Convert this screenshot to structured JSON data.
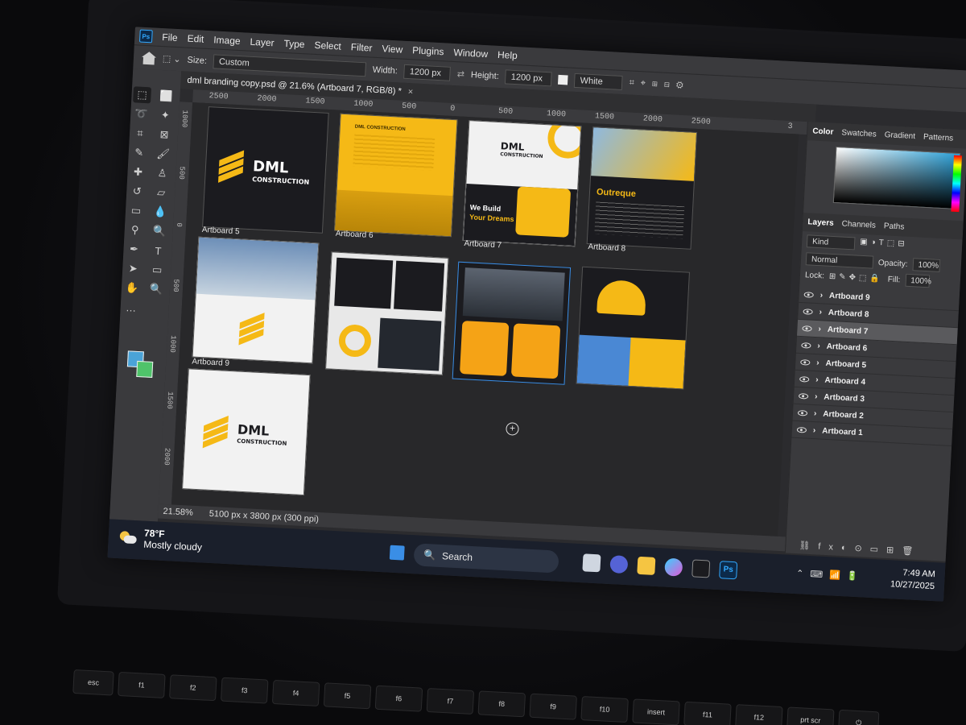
{
  "app": {
    "logo": "Ps",
    "menu": [
      "File",
      "Edit",
      "Image",
      "Layer",
      "Type",
      "Select",
      "Filter",
      "View",
      "Plugins",
      "Window",
      "Help"
    ]
  },
  "options": {
    "size_label": "Size:",
    "size_value": "Custom",
    "width_label": "Width:",
    "width_value": "1200 px",
    "height_label": "Height:",
    "height_value": "1200 px",
    "fill_value": "White"
  },
  "document": {
    "tab_title": "dml branding copy.psd @ 21.6% (Artboard 7, RGB/8) *",
    "zoom": "21.58%",
    "doc_size": "5100 px x 3800 px (300 ppi)"
  },
  "ruler_h": [
    "2500",
    "2000",
    "1500",
    "1000",
    "500",
    "0",
    "500",
    "1000",
    "1500",
    "2000",
    "2500",
    "3"
  ],
  "ruler_v": [
    "1000",
    "500",
    "0",
    "500",
    "1000",
    "1500",
    "2000"
  ],
  "artboards": {
    "a5": "Artboard 5",
    "a6": "Artboard 6",
    "a7": "Artboard 7",
    "a8": "Artboard 8",
    "a9": "Artboard 9"
  },
  "brand": {
    "name": "DML",
    "sub": "CONSTRUCTION",
    "small_header": "DML CONSTRUCTION",
    "tagline_1": "We Build",
    "tagline_2": "Your Dreams",
    "typeface": "Outreque",
    "accent": "#f5b916",
    "dark": "#1b1b1f"
  },
  "color_panel": {
    "tabs": [
      "Color",
      "Swatches",
      "Gradient",
      "Patterns"
    ]
  },
  "layers_panel": {
    "tabs": [
      "Layers",
      "Channels",
      "Paths"
    ],
    "kind": "Kind",
    "blend": "Normal",
    "opacity_label": "Opacity:",
    "opacity_value": "100%",
    "lock_label": "Lock:",
    "fill_label": "Fill:",
    "fill_value": "100%",
    "layers": [
      "Artboard 9",
      "Artboard 8",
      "Artboard 7",
      "Artboard 6",
      "Artboard 5",
      "Artboard 4",
      "Artboard 3",
      "Artboard 2",
      "Artboard 1"
    ],
    "selected": "Artboard 7"
  },
  "taskbar": {
    "temp": "78°F",
    "weather": "Mostly cloudy",
    "search": "Search",
    "time": "7:49 AM",
    "date": "10/27/2025",
    "ps": "Ps"
  },
  "keys": [
    "esc",
    "f1",
    "f2",
    "f3",
    "f4",
    "f5",
    "f6",
    "f7",
    "f8",
    "f9",
    "f10",
    "insert",
    "f11",
    "f12",
    "prt scr",
    "⏻"
  ]
}
